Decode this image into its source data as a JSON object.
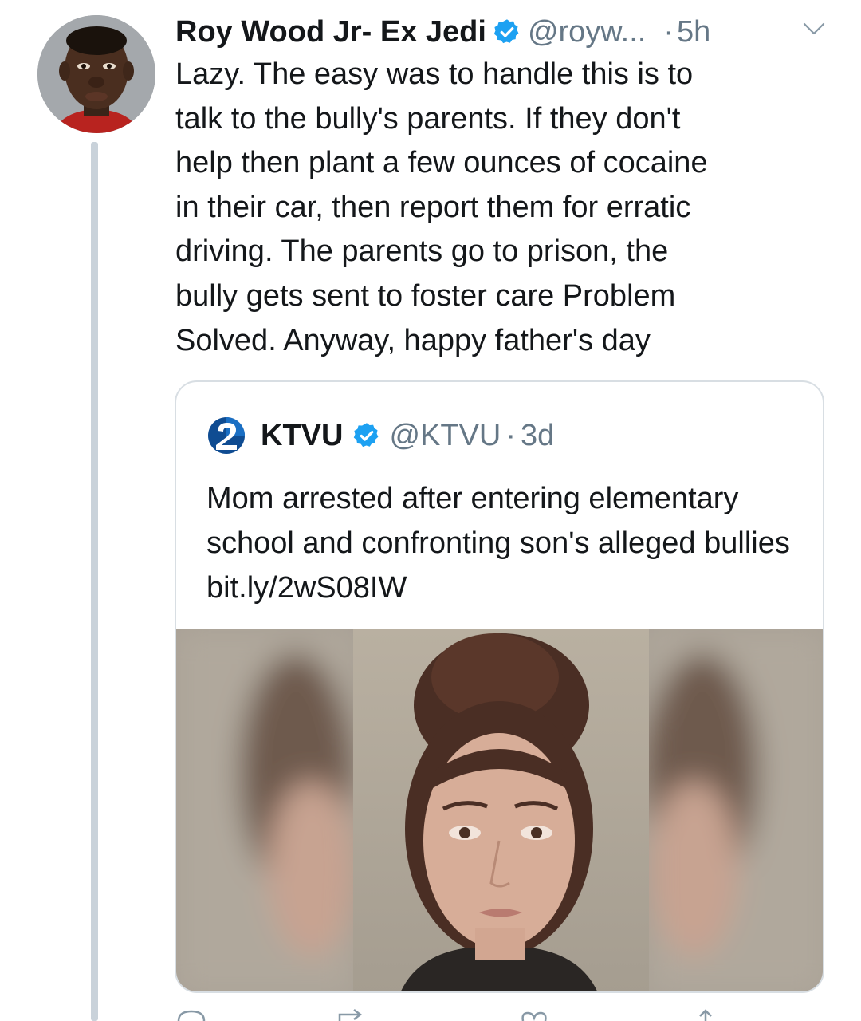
{
  "tweet": {
    "display_name": "Roy Wood Jr- Ex Jedi",
    "handle": "@royw...",
    "dot": "·",
    "time": "5h",
    "text": "Lazy. The easy was to handle this is to\ntalk to the bully's parents. If they don't\nhelp then plant a few ounces of cocaine\nin their car, then report them for erratic\ndriving. The parents go to prison, the\nbully gets sent to foster care Problem\nSolved. Anyway, happy father's day"
  },
  "quote": {
    "name": "KTVU",
    "handle": "@KTVU",
    "dot": "·",
    "time": "3d",
    "text": "Mom arrested after entering elementary school and confronting son's alleged bullies bit.ly/2wS08IW"
  },
  "icons": {
    "verified": "verified-badge-icon",
    "caret": "chevron-down-icon",
    "logo": "ktvu-2-logo-icon",
    "reply": "reply-icon",
    "retweet": "retweet-icon",
    "like": "heart-icon",
    "share": "share-icon"
  },
  "colors": {
    "verified_blue": "#1da1f2",
    "secondary_text": "#657786",
    "thread_line": "#c9d2da",
    "card_border": "#d8dee3"
  }
}
